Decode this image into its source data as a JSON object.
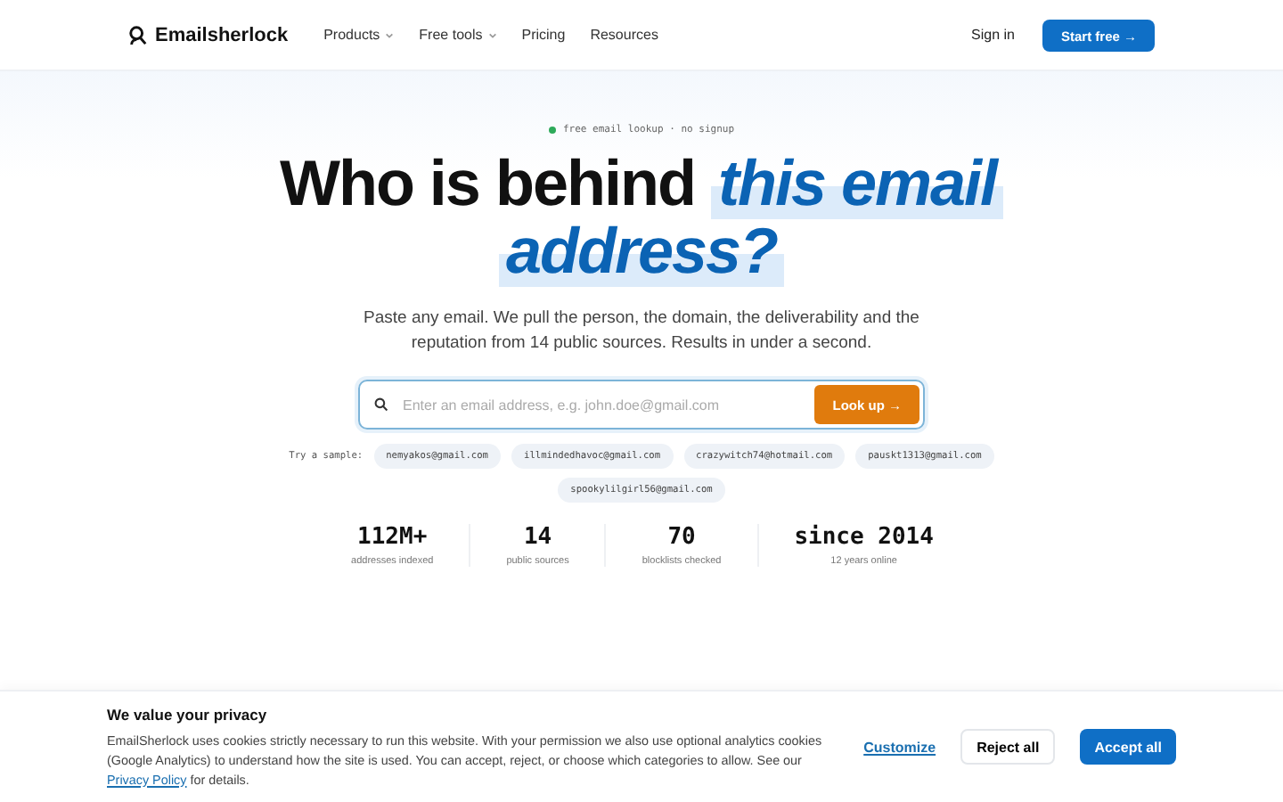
{
  "nav": {
    "brand": "Emailsherlock",
    "items": [
      {
        "label": "Products",
        "dropdown": true
      },
      {
        "label": "Free tools",
        "dropdown": true
      },
      {
        "label": "Pricing",
        "dropdown": false
      },
      {
        "label": "Resources",
        "dropdown": false
      }
    ],
    "sign_in": "Sign in",
    "cta": "Start free →"
  },
  "hero": {
    "eyebrow": "free email lookup · no signup",
    "title_plain": "Who is behind",
    "title_highlight_1": "this email",
    "title_highlight_2": "address?",
    "subtitle": "Paste any email. We pull the person, the domain, the deliverability and the reputation from 14 public sources. Results in under a second.",
    "search": {
      "placeholder": "Enter an email address, e.g. john.doe@gmail.com",
      "button": "Look up →"
    },
    "samples_label": "Try a sample:",
    "samples": [
      "nemyakos@gmail.com",
      "illmindedhavoc@gmail.com",
      "crazywitch74@hotmail.com",
      "pauskt1313@gmail.com",
      "spookylilgirl56@gmail.com"
    ],
    "stats": [
      {
        "value": "112M+",
        "label": "addresses indexed"
      },
      {
        "value": "14",
        "label": "public sources"
      },
      {
        "value": "70",
        "label": "blocklists checked"
      },
      {
        "value": "since 2014",
        "label": "12 years online"
      }
    ]
  },
  "cookie": {
    "title": "We value your privacy",
    "text": "EmailSherlock uses cookies strictly necessary to run this website. With your permission we also use optional analytics cookies (Google Analytics) to understand how the site is used. You can accept, reject, or choose which categories to allow. See our",
    "link": "Privacy Policy",
    "text_end": "for details.",
    "customize": "Customize",
    "reject": "Reject all",
    "accept": "Accept all"
  }
}
